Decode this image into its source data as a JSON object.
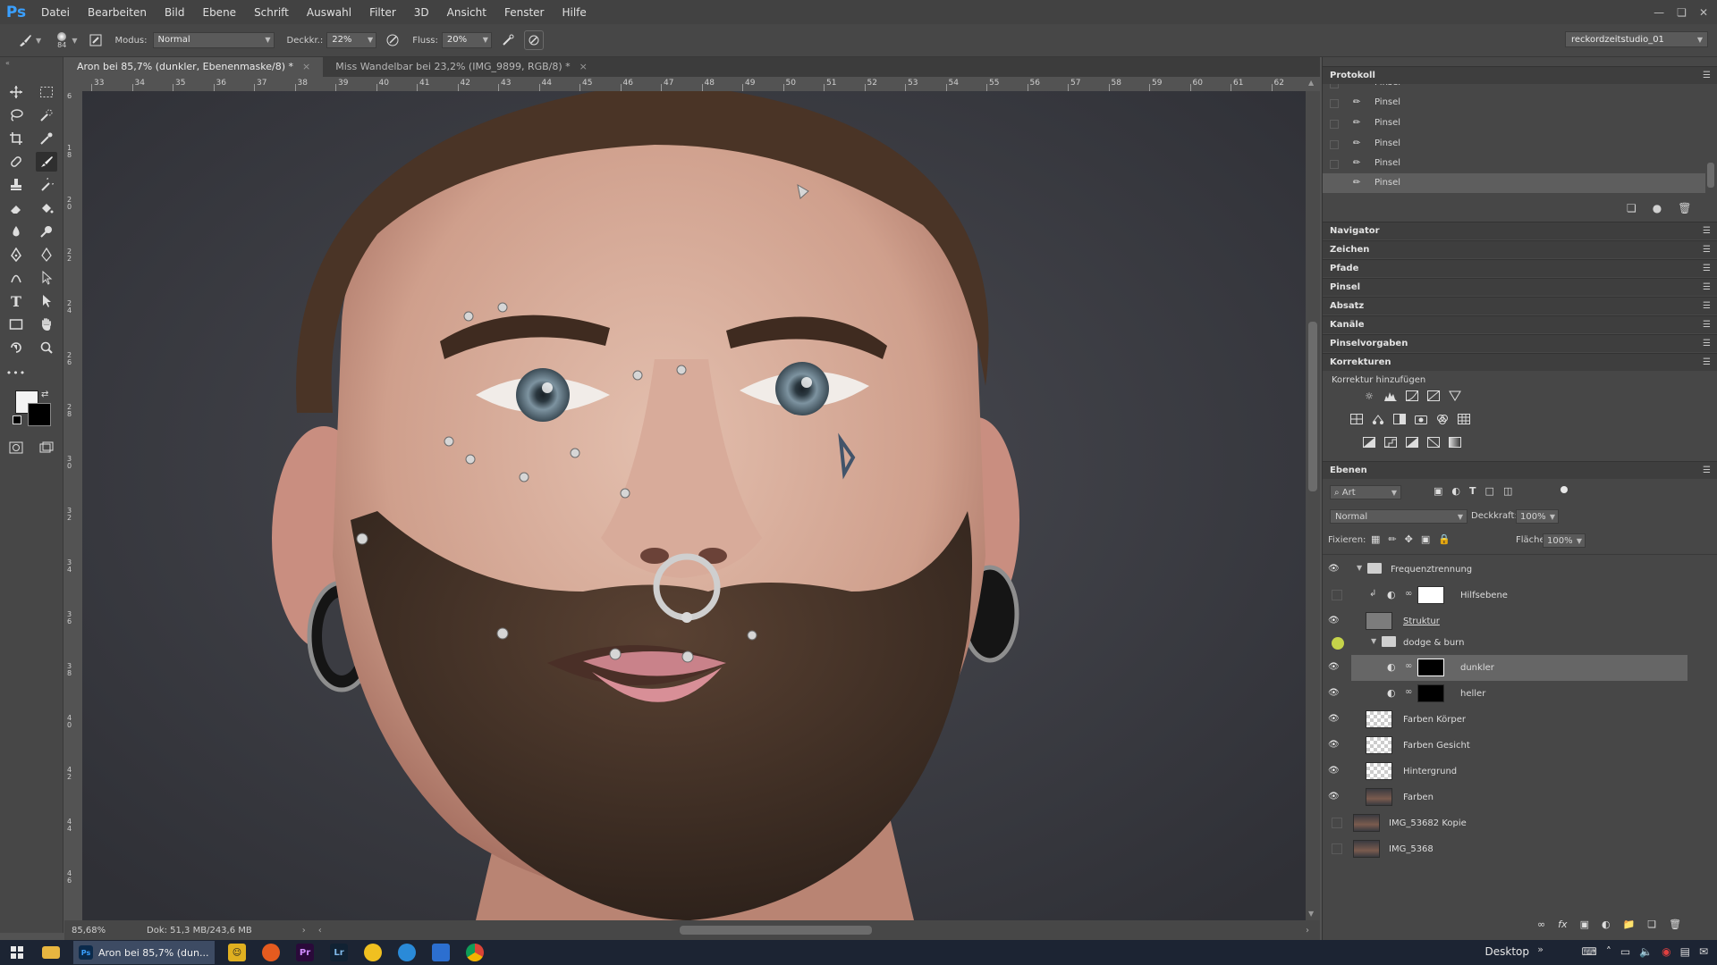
{
  "app": {
    "logo": "Ps",
    "menu": [
      "Datei",
      "Bearbeiten",
      "Bild",
      "Ebene",
      "Schrift",
      "Auswahl",
      "Filter",
      "3D",
      "Ansicht",
      "Fenster",
      "Hilfe"
    ]
  },
  "options": {
    "brush_size": "84",
    "modus_label": "Modus:",
    "modus_value": "Normal",
    "deckkraft_label": "Deckkr.:",
    "deckkraft_value": "22%",
    "fluss_label": "Fluss:",
    "fluss_value": "20%",
    "workspace": "reckordzeitstudio_01"
  },
  "tabs": [
    {
      "title": "Aron bei 85,7% (dunkler, Ebenenmaske/8) *",
      "active": true
    },
    {
      "title": "Miss Wandelbar bei 23,2% (IMG_9899, RGB/8) *",
      "active": false
    }
  ],
  "rulers": {
    "top": [
      "33",
      "34",
      "35",
      "36",
      "37",
      "38",
      "39",
      "40",
      "41",
      "42",
      "43",
      "44",
      "45",
      "46",
      "47",
      "48",
      "49",
      "50",
      "51",
      "52",
      "53",
      "54",
      "55",
      "56",
      "57",
      "58",
      "59",
      "60",
      "61",
      "62"
    ],
    "left": [
      "6",
      "1 8",
      "2 0",
      "2 2",
      "2 4",
      "2 6",
      "2 8",
      "3 0",
      "3 2",
      "3 4",
      "3 6",
      "3 8",
      "4 0",
      "4 2",
      "4 4",
      "4 6"
    ]
  },
  "status": {
    "zoom": "85,68%",
    "doc": "Dok: 51,3 MB/243,6 MB"
  },
  "history": {
    "title": "Protokoll",
    "items": [
      "Pinsel",
      "Pinsel",
      "Pinsel",
      "Pinsel",
      "Pinsel",
      "Pinsel"
    ],
    "selected_index": 5
  },
  "collapsed_panels": [
    "Navigator",
    "Zeichen",
    "Pfade",
    "Pinsel",
    "Absatz",
    "Kanäle",
    "Pinselvorgaben"
  ],
  "corrections": {
    "title": "Korrekturen",
    "add_label": "Korrektur hinzufügen"
  },
  "layers_panel": {
    "title": "Ebenen",
    "filter": "Art",
    "blend_mode": "Normal",
    "opacity_label": "Deckkraft:",
    "opacity_value": "100%",
    "lock_label": "Fixieren:",
    "fill_label": "Fläche:",
    "fill_value": "100%",
    "layers": [
      {
        "name": "Frequenztrennung",
        "type": "group",
        "visible": true
      },
      {
        "name": "Hilfsebene",
        "type": "adjustment",
        "visible": false
      },
      {
        "name": "Struktur",
        "type": "pixel-gray",
        "visible": true
      },
      {
        "name": "dodge & burn",
        "type": "group",
        "visible": true
      },
      {
        "name": "dunkler",
        "type": "adjustment",
        "visible": true,
        "selected": true
      },
      {
        "name": "heller",
        "type": "adjustment",
        "visible": true
      },
      {
        "name": "Farben Körper",
        "type": "transparent",
        "visible": true
      },
      {
        "name": "Farben Gesicht",
        "type": "transparent",
        "visible": true
      },
      {
        "name": "Hintergrund",
        "type": "transparent",
        "visible": true
      },
      {
        "name": "Farben",
        "type": "photo",
        "visible": true
      },
      {
        "name": "IMG_53682 Kopie",
        "type": "photo",
        "visible": false
      },
      {
        "name": "IMG_5368",
        "type": "photo",
        "visible": false
      }
    ]
  },
  "taskbar": {
    "active_window": "Aron bei 85,7% (dun...",
    "desktop_label": "Desktop"
  }
}
